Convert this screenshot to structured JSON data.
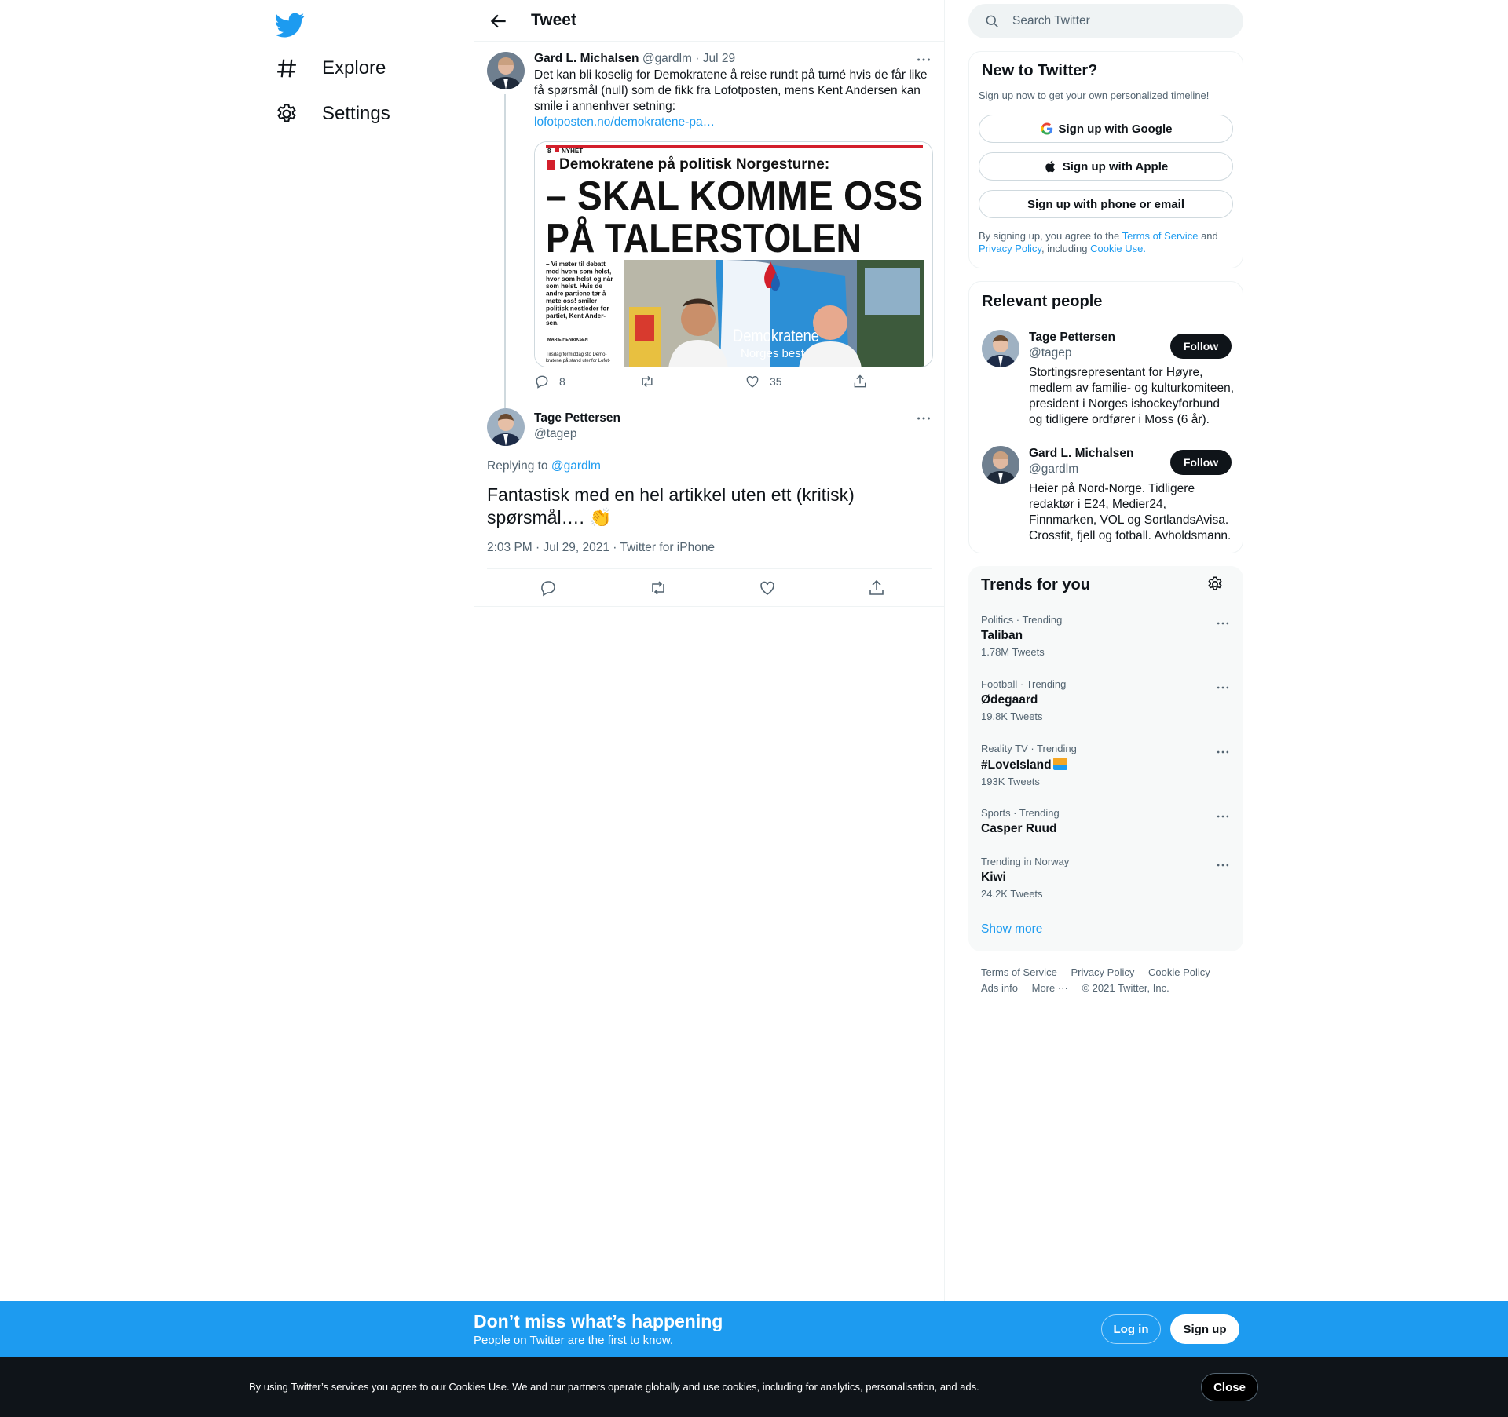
{
  "colors": {
    "brand": "#1d9bf0",
    "text": "#0f1419",
    "muted": "#536471",
    "dark": "#0f1419"
  },
  "nav": {
    "items": [
      {
        "label": "Explore",
        "icon": "hashtag-icon"
      },
      {
        "label": "Settings",
        "icon": "gear-icon"
      }
    ]
  },
  "header": {
    "title": "Tweet"
  },
  "tweet1": {
    "name": "Gard L. Michalsen",
    "handle": "@gardlm",
    "date": "· Jul 29",
    "text": "Det kan bli koselig for Demokratene å reise rundt på turné hvis de får like få spørsmål (null) som de fikk fra Lofotposten, mens Kent Andersen kan smile i annenhver setning:",
    "link": "lofotposten.no/demokratene-pa…",
    "media": {
      "page_num": "8",
      "section": "NYHET",
      "kicker": "Demokratene på politisk Norgesturne:",
      "headline1": "– SKAL KOMME OSS",
      "headline2": "PÅ TALERSTOLEN",
      "lead": [
        "– Vi møter til debatt",
        "med hvem som helst,",
        "hvor som helst og når",
        "som helst. Hvis de",
        "andre partiene tør å",
        "møte oss! smiler",
        "politisk nestleder for",
        "partiet, Kent Ander-",
        "sen."
      ],
      "byline": "MARIE HENRIKSEN",
      "caption": [
        "Tirsdag formiddag sto Demo-",
        "kratene på stand utenfor Lofot-"
      ],
      "banner_word": "Demokratene",
      "banner_sub": "Norges beste"
    },
    "replies": "8",
    "likes": "35"
  },
  "tweet2": {
    "name": "Tage Pettersen",
    "handle": "@tagep",
    "replying_prefix": "Replying to",
    "replying_to": "@gardlm",
    "text": "Fantastisk med en hel artikkel uten ett (kritisk) spørsmål…. 👏",
    "meta": "2:03 PM · Jul 29, 2021 · Twitter for iPhone"
  },
  "search": {
    "placeholder": "Search Twitter"
  },
  "new_to_twitter": {
    "title": "New to Twitter?",
    "subtitle": "Sign up now to get your own personalized timeline!",
    "google": "Sign up with Google",
    "apple": "Sign up with Apple",
    "phone": "Sign up with phone or email",
    "legal_1": "By signing up, you agree to the",
    "tos": "Terms of Service",
    "legal_and": "and",
    "privacy": "Privacy Policy",
    "legal_including": ", including",
    "cookie": "Cookie Use."
  },
  "relevant": {
    "title": "Relevant people",
    "people": [
      {
        "name": "Tage Pettersen",
        "handle": "@tagep",
        "follow": "Follow",
        "bio": "Stortingsrepresentant for Høyre, medlem av familie- og kulturkomiteen, president i Norges ishockeyforbund og tidligere ordfører i Moss (6 år)."
      },
      {
        "name": "Gard L. Michalsen",
        "handle": "@gardlm",
        "follow": "Follow",
        "bio": "Heier på Nord-Norge. Tidligere redaktør i E24, Medier24, Finnmarken, VOL og SortlandsAvisa. Crossfit, fjell og fotball. Avholdsmann."
      }
    ]
  },
  "trends": {
    "title": "Trends for you",
    "items": [
      {
        "category": "Politics · Trending",
        "title": "Taliban",
        "count": "1.78M Tweets"
      },
      {
        "category": "Football · Trending",
        "title": "Ødegaard",
        "count": "19.8K Tweets"
      },
      {
        "category": "Reality TV · Trending",
        "title": "#LoveIsland",
        "count": "193K Tweets"
      },
      {
        "category": "Sports · Trending",
        "title": "Casper Ruud",
        "count": ""
      },
      {
        "category": "Trending in Norway",
        "title": "Kiwi",
        "count": "24.2K Tweets"
      }
    ],
    "show_more": "Show more"
  },
  "footer": {
    "links1": [
      "Terms of Service",
      "Privacy Policy",
      "Cookie Policy"
    ],
    "links2": [
      "Ads info",
      "More ···",
      "© 2021 Twitter, Inc."
    ]
  },
  "banner": {
    "title": "Don’t miss what’s happening",
    "subtitle": "People on Twitter are the first to know.",
    "login": "Log in",
    "signup": "Sign up"
  },
  "cookie_bar": {
    "text": "By using Twitter’s services you agree to our Cookies Use. We and our partners operate globally and use cookies, including for analytics, personalisation, and ads.",
    "close": "Close"
  }
}
